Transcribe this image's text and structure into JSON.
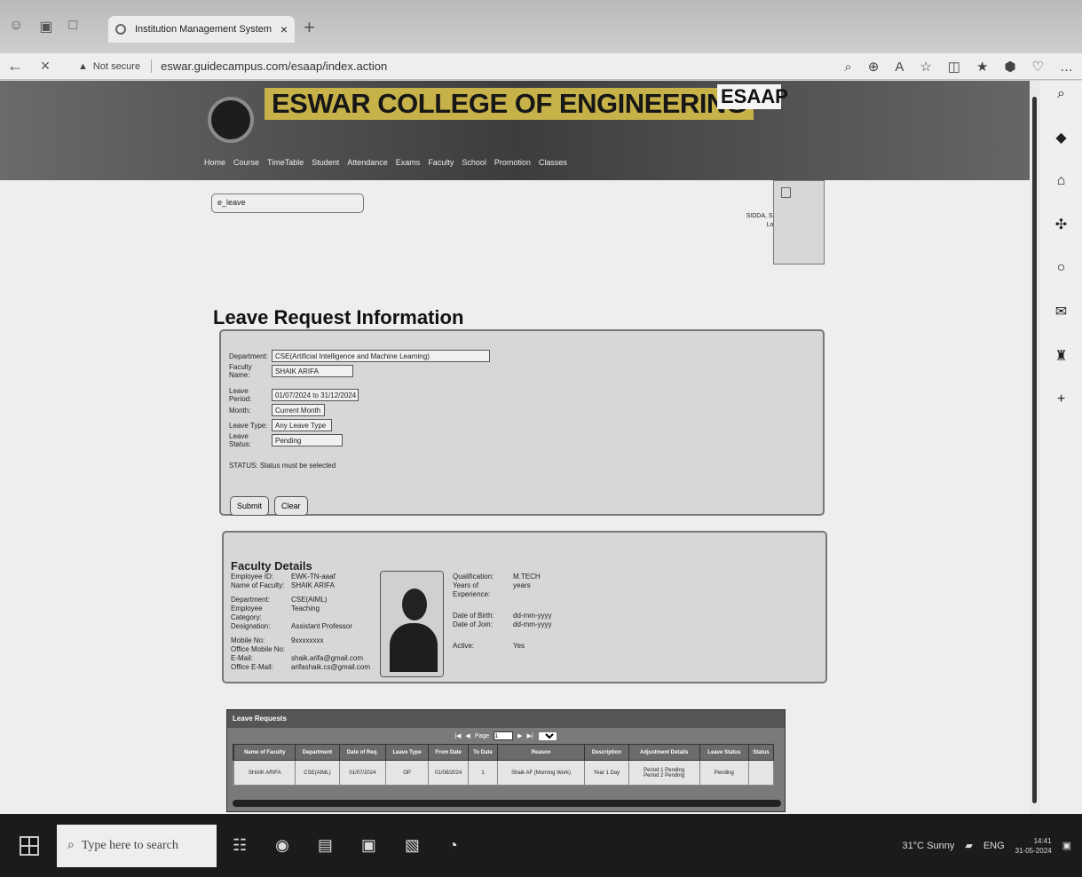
{
  "browser": {
    "tab_title": "Institution Management System",
    "tab_close": "×",
    "new_tab": "+",
    "security": "Not secure",
    "url": "eswar.guidecampus.com/esaap/index.action",
    "back": "←",
    "stop": "×"
  },
  "site": {
    "college_name": "ESWAR COLLEGE OF ENGINEERING",
    "brand": "ESAAP",
    "menu": [
      "Home",
      "Course",
      "TimeTable",
      "Student",
      "Attendance",
      "Exams",
      "Faculty",
      "School",
      "Promotion",
      "Classes"
    ],
    "selector": "e_leave",
    "profile": "SIDDA, SACE\nLogout"
  },
  "page": {
    "title": "Leave Request Information",
    "department_label": "Department:",
    "department": "CSE(Artificial Intelligence and Machine Learning)",
    "faculty_label": "Faculty Name:",
    "faculty": "SHAIK ARIFA",
    "period_label": "Leave Period:",
    "period": "01/07/2024 to 31/12/2024",
    "month_label": "Month:",
    "month": "Current Month",
    "type_label": "Leave Type:",
    "type": "Any Leave Type",
    "status_label": "Leave Status:",
    "status": "Pending",
    "error": "STATUS: Status must be selected",
    "submit": "Submit",
    "clear": "Clear"
  },
  "faculty_details": {
    "heading": "Faculty Details",
    "left": [
      [
        "Employee ID:",
        "EWK-TN-aaaf"
      ],
      [
        "Name of Faculty:",
        "SHAIK ARIFA"
      ],
      [
        "Department:",
        "CSE(AIML)"
      ],
      [
        "Employee Category:",
        "Teaching"
      ],
      [
        "Designation:",
        "Assistant Professor"
      ],
      [
        "Mobile No:",
        "9xxxxxxxx"
      ],
      [
        "Office Mobile No:",
        ""
      ],
      [
        "E-Mail:",
        "shaik.arifa@gmail.com"
      ],
      [
        "Office E-Mail:",
        "arifashaik.cs@gmail.com"
      ]
    ],
    "right": [
      [
        "Qualification:",
        "M.TECH"
      ],
      [
        "Years of Experience:",
        "years"
      ],
      [
        "Date of Birth:",
        "dd-mm-yyyy"
      ],
      [
        "Date of Join:",
        "dd-mm-yyyy"
      ],
      [
        "Active:",
        "Yes"
      ]
    ]
  },
  "leave_grid": {
    "title": "Leave Requests",
    "page_label": "Page",
    "page_value": "1",
    "headers": [
      "",
      "Name of Faculty",
      "Department",
      "Date of Req.",
      "Leave Type",
      "From Date",
      "To Date",
      "Reason",
      "Description",
      "Adjustment Details",
      "Leave Status",
      "Status"
    ],
    "row": [
      "",
      "SHAIK ARIFA",
      "CSE(AIML)",
      "01/07/2024",
      "OP",
      "01/08/2024",
      "1",
      "Shaik AF (Morning Work)",
      "Year 1 Day",
      "Period 1 Pending\nPeriod 2 Pending",
      "Pending",
      ""
    ]
  },
  "taskbar": {
    "search_placeholder": "Type here to search",
    "weather": "31°C Sunny",
    "language": "ENG",
    "time": "14:41",
    "date": "31-05-2024"
  }
}
